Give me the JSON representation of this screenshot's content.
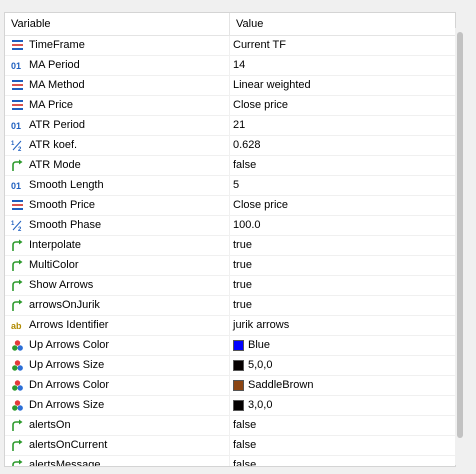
{
  "header": {
    "variable": "Variable",
    "value": "Value"
  },
  "rows": [
    {
      "icon": "enum-icon",
      "name": "TimeFrame",
      "value": "Current TF"
    },
    {
      "icon": "int-icon",
      "name": "MA Period",
      "value": "14"
    },
    {
      "icon": "enum-icon",
      "name": "MA Method",
      "value": "Linear weighted"
    },
    {
      "icon": "enum-icon",
      "name": "MA Price",
      "value": "Close price"
    },
    {
      "icon": "int-icon",
      "name": "ATR Period",
      "value": "21"
    },
    {
      "icon": "double-icon",
      "name": "ATR koef.",
      "value": "0.628"
    },
    {
      "icon": "bool-icon",
      "name": "ATR Mode",
      "value": "false"
    },
    {
      "icon": "int-icon",
      "name": "Smooth Length",
      "value": "5"
    },
    {
      "icon": "enum-icon",
      "name": "Smooth Price",
      "value": "Close price"
    },
    {
      "icon": "double-icon",
      "name": "Smooth Phase",
      "value": "100.0"
    },
    {
      "icon": "bool-icon",
      "name": "Interpolate",
      "value": "true"
    },
    {
      "icon": "bool-icon",
      "name": "MultiColor",
      "value": "true"
    },
    {
      "icon": "bool-icon",
      "name": "Show Arrows",
      "value": "true"
    },
    {
      "icon": "bool-icon",
      "name": "arrowsOnJurik",
      "value": "true"
    },
    {
      "icon": "string-icon",
      "name": "Arrows Identifier",
      "value": "jurik arrows"
    },
    {
      "icon": "color-icon",
      "name": "Up Arrows Color",
      "value": "Blue",
      "swatch": "#0000ff"
    },
    {
      "icon": "color-icon",
      "name": "Up Arrows Size",
      "value": "5,0,0",
      "swatch": "#050000"
    },
    {
      "icon": "color-icon",
      "name": "Dn Arrows Color",
      "value": "SaddleBrown",
      "swatch": "#8b4513"
    },
    {
      "icon": "color-icon",
      "name": "Dn Arrows Size",
      "value": "3,0,0",
      "swatch": "#030000"
    },
    {
      "icon": "bool-icon",
      "name": "alertsOn",
      "value": "false"
    },
    {
      "icon": "bool-icon",
      "name": "alertsOnCurrent",
      "value": "false"
    },
    {
      "icon": "bool-icon",
      "name": "alertsMessage",
      "value": "false"
    }
  ],
  "colors": {
    "enum": "#1f5fbf",
    "int": "#1f5fbf",
    "double": "#1f5fbf",
    "bool": "#2e9b2e",
    "string": "#b08a00",
    "color_dots": [
      "#e23a3a",
      "#2e9b2e",
      "#2d6fd6"
    ]
  }
}
